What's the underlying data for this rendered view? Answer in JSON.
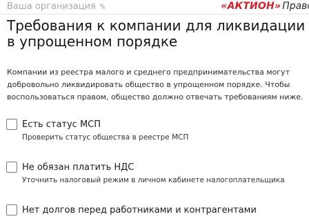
{
  "header": {
    "organization_placeholder": "Ваша организация",
    "brand_logo": "«АКТИОН»",
    "brand_suffix": "Право",
    "colors": {
      "brand_red": "#d4202b",
      "muted": "#a9a9a9"
    }
  },
  "main": {
    "title": "Требования к компании для ликвидации в упрощенном порядке",
    "intro": "Компании из реестра малого и среднего предпринимательства могут добровольно ликвидировать общество в упрощенном порядке. Чтобы воспользоваться правом, общество должно отвечать требованиям ниже.",
    "requirements": [
      {
        "label": "Есть статус МСП",
        "checked": false,
        "action": "Проверить статус общества в реестре МСП"
      },
      {
        "label": "Не обязан платить НДС",
        "checked": false,
        "action": "Уточнить налоговый режим в личном кабинете налогоплательщика"
      },
      {
        "label": "Нет долгов перед работниками и контрагентами",
        "checked": false
      }
    ]
  },
  "icons": {
    "edit": "pencil-icon",
    "checkbox": "checkbox-icon"
  }
}
